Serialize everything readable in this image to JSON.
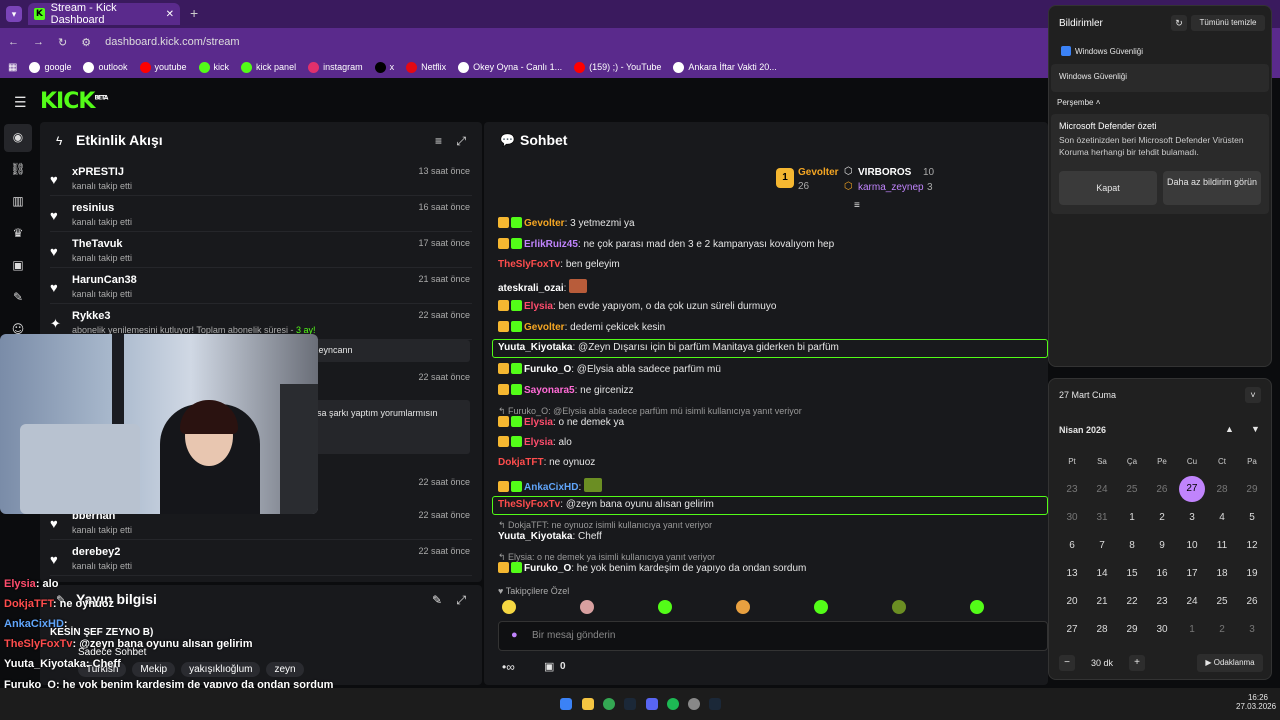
{
  "browser": {
    "tab_title": "Stream - Kick Dashboard",
    "url": "dashboard.kick.com/stream",
    "bookmarks": [
      {
        "label": "google",
        "color": "#ffffff"
      },
      {
        "label": "outlook",
        "color": "#ffffff"
      },
      {
        "label": "youtube",
        "color": "#ff0000"
      },
      {
        "label": "kick",
        "color": "#53fc18"
      },
      {
        "label": "kick panel",
        "color": "#53fc18"
      },
      {
        "label": "instagram",
        "color": "#e1306c"
      },
      {
        "label": "x",
        "color": "#000000"
      },
      {
        "label": "Netflix",
        "color": "#e50914"
      },
      {
        "label": "Okey Oyna - Canlı 1...",
        "color": "#ffffff"
      },
      {
        "label": "(159) ;) - YouTube",
        "color": "#ff0000"
      },
      {
        "label": "Ankara İftar Vakti 20...",
        "color": "#ffffff"
      }
    ]
  },
  "kick": {
    "logo": "KICK",
    "beta": "BETA"
  },
  "activity": {
    "title": "Etkinlik Akışı",
    "items": [
      {
        "name": "xPRESTIJ",
        "action": "kanalı takip etti",
        "time": "13 saat önce"
      },
      {
        "name": "resinius",
        "action": "kanalı takip etti",
        "time": "16 saat önce"
      },
      {
        "name": "TheTavuk",
        "action": "kanalı takip etti",
        "time": "17 saat önce"
      },
      {
        "name": "HarunCan38",
        "action": "kanalı takip etti",
        "time": "21 saat önce"
      },
      {
        "name": "Rykke3",
        "action": "abonelik yenilemesini kutluyor! Toplam abonelik süresi - ",
        "time": "22 saat önce",
        "extra": "3 ay!"
      },
      {
        "name": "bberhan",
        "action": "kanalı takip etti",
        "time": "22 saat önce"
      },
      {
        "name": "derebey2",
        "action": "kanalı takip etti",
        "time": "22 saat önce"
      }
    ],
    "partial_texts": [
      "zeyncann",
      "22 saat önce",
      "rsa şarkı yaptım yorumlarmısın",
      "22 saat önce"
    ]
  },
  "stream_info": {
    "title": "Yayın bilgisi",
    "tags": [
      "Turkish",
      "Mekip",
      "yakışıklıoğlum",
      "zeyn"
    ],
    "subtitle": "KESİN ŞEF ZEYNO B)",
    "category": "Sadece Sohbet"
  },
  "chat": {
    "title": "Sohbet",
    "leaderboard": [
      {
        "rank": "1",
        "name": "Gevolter",
        "count": "26"
      },
      {
        "name": "VIRBOROS",
        "count": "10"
      },
      {
        "name": "karma_zeynep",
        "count": "3"
      }
    ],
    "messages": [
      {
        "user": "Gevolter",
        "color": "#f5a623",
        "text": "3 yetmezmi ya"
      },
      {
        "user": "ErlikRuiz45",
        "color": "#c084fc",
        "text": "ne çok parası mad den 3 e 2 kampanyası kovalıyom hep"
      },
      {
        "user": "TheSlyFoxTv",
        "color": "#ff4d4d",
        "text": "ben geleyim"
      },
      {
        "user": "ateskrali_ozai",
        "color": "#ffffff",
        "text": ""
      },
      {
        "user": "Elysia",
        "color": "#ff4d6d",
        "text": "ben evde yapıyom, o da çok uzun süreli durmuyo"
      },
      {
        "user": "Gevolter",
        "color": "#f5a623",
        "text": "dedemi çekicek kesin"
      },
      {
        "user": "Yuuta_Kiyotaka",
        "color": "#ffffff",
        "text": "@Zeyn Dışarısı için bi parfüm Manitaya giderken bi parfüm"
      },
      {
        "user": "Furuko_O",
        "color": "#ffffff",
        "text": "@Elysia abla sadece parfüm mü"
      },
      {
        "user": "Sayonara5",
        "color": "#ff6bd6",
        "text": "ne gircenizz"
      },
      {
        "reply": "Furuko_O: @Elysia abla sadece parfüm mü isimli kullanıcıya yanıt veriyor"
      },
      {
        "user": "Elysia",
        "color": "#ff4d6d",
        "text": "o ne demek ya"
      },
      {
        "user": "Elysia",
        "color": "#ff4d6d",
        "text": "alo"
      },
      {
        "user": "DokjaTFT",
        "color": "#ff4d4d",
        "text": "ne oynuoz"
      },
      {
        "user": "AnkaCixHD",
        "color": "#60a5fa",
        "text": ""
      },
      {
        "user": "TheSlyFoxTv",
        "color": "#ff4d4d",
        "text": "@zeyn bana oyunu alısan gelirim"
      },
      {
        "reply": "DokjaTFT: ne oynuoz isimli kullanıcıya yanıt veriyor"
      },
      {
        "user": "Yuuta_Kiyotaka",
        "color": "#ffffff",
        "text": "Cheff"
      },
      {
        "reply": "Elysia: o ne demek ya isimli kullanıcıya yanıt veriyor"
      },
      {
        "user": "Furuko_O",
        "color": "#ffffff",
        "text": "he yok benim kardeşim de yapıyo da ondan sordum"
      }
    ],
    "emote_label": "Takipçilere Özel",
    "input_placeholder": "Bir mesaj gönderin",
    "count": "0"
  },
  "overlay": [
    {
      "user": "Elysia",
      "color": "#ff4d6d",
      "text": ": alo"
    },
    {
      "user": "DokjaTFT",
      "color": "#ff4d4d",
      "text": ": ne oynuoz"
    },
    {
      "user": "AnkaCixHD",
      "color": "#60a5fa",
      "text": ":"
    },
    {
      "user": "TheSlyFoxTv",
      "color": "#ff4d4d",
      "text": ": @zeyn bana oyunu alısan gelirim"
    },
    {
      "user": "Yuuta_Kiyotaka",
      "color": "#ffffff",
      "text": ": Cheff"
    },
    {
      "user": "Furuko_O",
      "color": "#ffffff",
      "text": ": he yok benim kardeşim de yapıyo da ondan sordum"
    }
  ],
  "notifications": {
    "title": "Bildirimler",
    "clear_all": "Tümünü temizle",
    "app": "Windows Güvenliği",
    "group": "Windows Güvenliği",
    "day": "Perşembe",
    "heading": "Microsoft Defender özeti",
    "body": "Son özetinizden beri Microsoft Defender Virüsten Koruma herhangi bir tehdit bulamadı.",
    "btn_close": "Kapat",
    "btn_less": "Daha az bildirim görün"
  },
  "calendar": {
    "date_header": "27 Mart Cuma",
    "month": "Nisan 2026",
    "weekdays": [
      "Pt",
      "Sa",
      "Ça",
      "Pe",
      "Cu",
      "Ct",
      "Pa"
    ],
    "weeks": [
      [
        "23",
        "24",
        "25",
        "26",
        "27",
        "28",
        "29"
      ],
      [
        "30",
        "31",
        "1",
        "2",
        "3",
        "4",
        "5"
      ],
      [
        "6",
        "7",
        "8",
        "9",
        "10",
        "11",
        "12"
      ],
      [
        "13",
        "14",
        "15",
        "16",
        "17",
        "18",
        "19"
      ],
      [
        "20",
        "21",
        "22",
        "23",
        "24",
        "25",
        "26"
      ],
      [
        "27",
        "28",
        "29",
        "30",
        "1",
        "2",
        "3"
      ]
    ],
    "focus_minutes": "30 dk",
    "focus_label": "Odaklanma"
  },
  "taskbar": {
    "time": "16:26",
    "date": "27.03.2026"
  }
}
